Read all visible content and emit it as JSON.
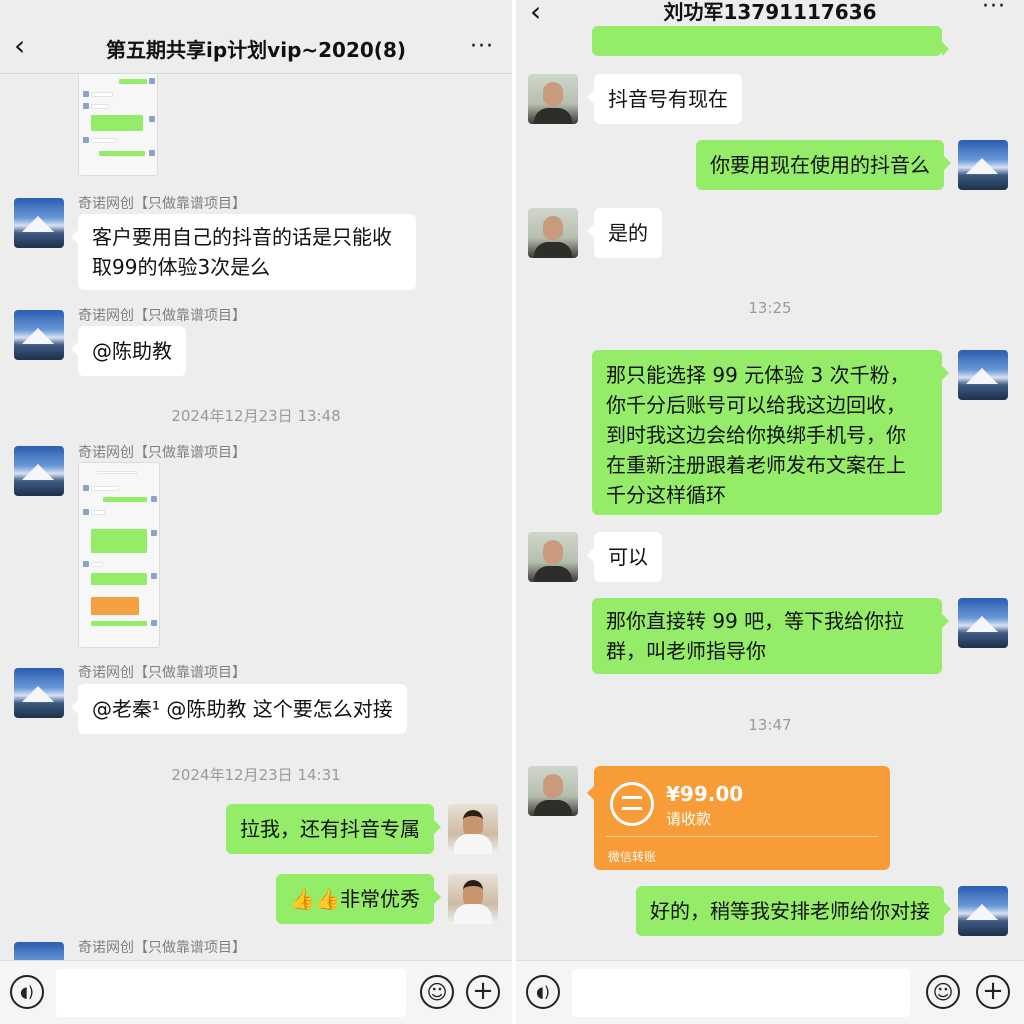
{
  "left": {
    "title": "第五期共享ip计划vip~2020(8)",
    "back_icon": "‹",
    "more_icon": "···",
    "messages": [
      {
        "sender": "奇诺网创【只做靠谱项目】",
        "text_line1": "客户要用自己的抖音的话是只能收",
        "text_line2": "取99的体验3次是么"
      },
      {
        "sender": "奇诺网创【只做靠谱项目】",
        "text": "@陈助教"
      },
      {
        "sender": "奇诺网创【只做靠谱项目】"
      },
      {
        "sender": "奇诺网创【只做靠谱项目】",
        "text": "@老秦¹ @陈助教 这个要怎么对接"
      },
      {
        "text": "拉我，还有抖音专属"
      },
      {
        "text": "👍👍非常优秀"
      },
      {
        "sender": "奇诺网创【只做靠谱项目】"
      }
    ],
    "timestamps": [
      "2024年12月23日 13:48",
      "2024年12月23日 14:31"
    ]
  },
  "right": {
    "title": "刘功军13791117636",
    "back_icon": "‹",
    "more_icon": "···",
    "messages": [
      {
        "text": "抖音号有现在"
      },
      {
        "text": "你要用现在使用的抖音么"
      },
      {
        "text": "是的"
      },
      {
        "lines": [
          "那只能选择 99 元体验 3 次千粉，",
          "你千分后账号可以给我这边回收，",
          "到时我这边会给你换绑手机号，你",
          "在重新注册跟着老师发布文案在上",
          "千分这样循环"
        ]
      },
      {
        "text": "可以"
      },
      {
        "lines": [
          "那你直接转 99 吧，等下我给你拉",
          "群，叫老师指导你"
        ]
      },
      {
        "text": "好的，稍等我安排老师给你对接"
      }
    ],
    "timestamps": [
      "13:25",
      "13:47"
    ],
    "transfer": {
      "amount": "¥99.00",
      "status": "请收款",
      "footer": "微信转账"
    }
  },
  "input": {
    "voice_icon": "◖)",
    "emoji_icon": "☺",
    "plus_icon": "+"
  },
  "colors": {
    "bubble_green": "#95ec69",
    "bubble_white": "#ffffff",
    "transfer_orange": "#f79c37",
    "background": "#ededed"
  },
  "icons": [
    "back-icon",
    "more-icon",
    "voice-icon",
    "emoji-icon",
    "plus-icon",
    "transfer-icon"
  ]
}
